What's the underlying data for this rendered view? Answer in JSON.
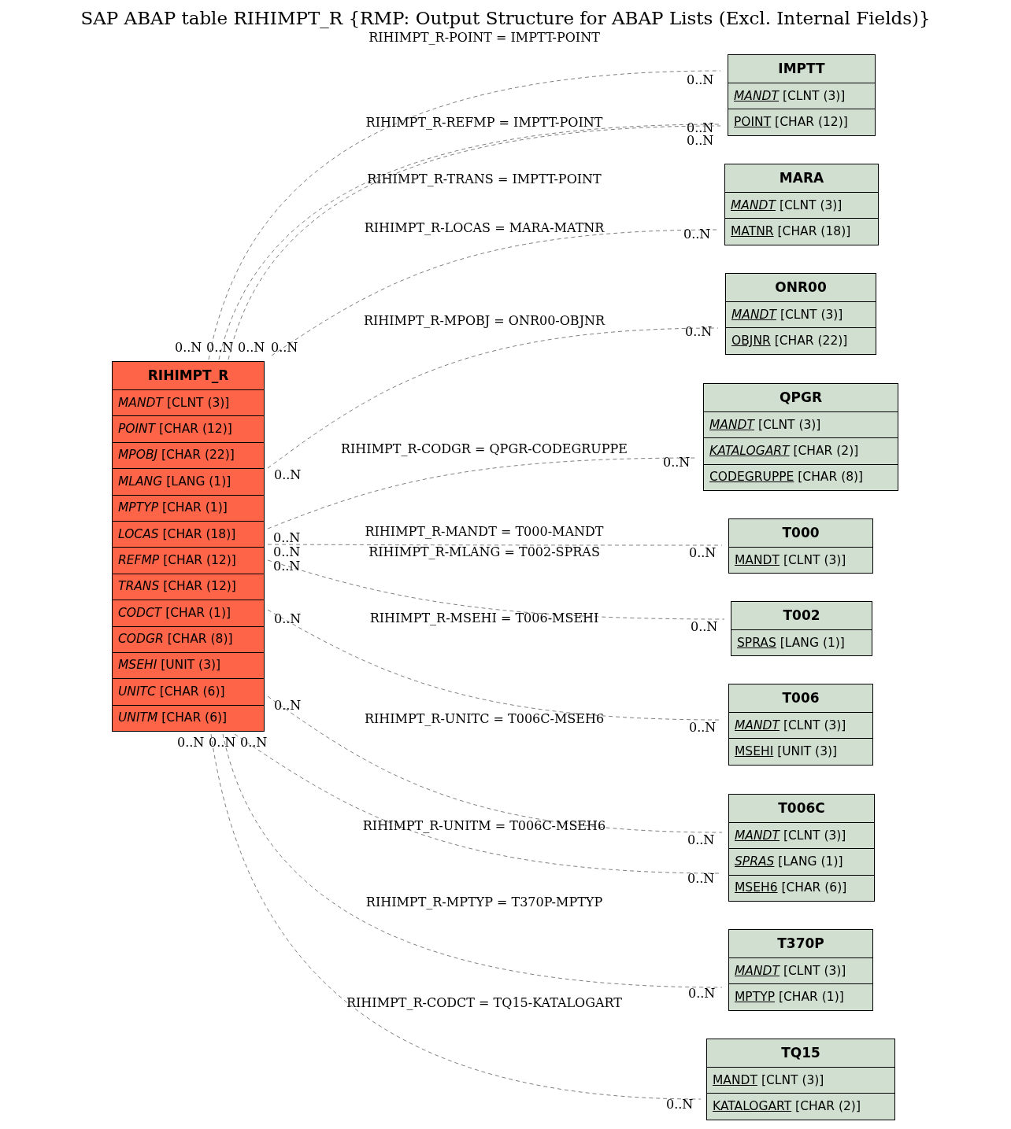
{
  "title": "SAP ABAP table RIHIMPT_R {RMP: Output Structure for ABAP Lists (Excl. Internal Fields)}",
  "main_table": {
    "name": "RIHIMPT_R",
    "fields": [
      {
        "name": "MANDT",
        "type": "[CLNT (3)]",
        "key": false,
        "italic": true
      },
      {
        "name": "POINT",
        "type": "[CHAR (12)]",
        "key": false,
        "italic": true
      },
      {
        "name": "MPOBJ",
        "type": "[CHAR (22)]",
        "key": false,
        "italic": true
      },
      {
        "name": "MLANG",
        "type": "[LANG (1)]",
        "key": false,
        "italic": true
      },
      {
        "name": "MPTYP",
        "type": "[CHAR (1)]",
        "key": false,
        "italic": true
      },
      {
        "name": "LOCAS",
        "type": "[CHAR (18)]",
        "key": false,
        "italic": true
      },
      {
        "name": "REFMP",
        "type": "[CHAR (12)]",
        "key": false,
        "italic": true
      },
      {
        "name": "TRANS",
        "type": "[CHAR (12)]",
        "key": false,
        "italic": true
      },
      {
        "name": "CODCT",
        "type": "[CHAR (1)]",
        "key": false,
        "italic": true
      },
      {
        "name": "CODGR",
        "type": "[CHAR (8)]",
        "key": false,
        "italic": true
      },
      {
        "name": "MSEHI",
        "type": "[UNIT (3)]",
        "key": false,
        "italic": true
      },
      {
        "name": "UNITC",
        "type": "[CHAR (6)]",
        "key": false,
        "italic": true
      },
      {
        "name": "UNITM",
        "type": "[CHAR (6)]",
        "key": false,
        "italic": true
      }
    ]
  },
  "tables": [
    {
      "name": "IMPTT",
      "fields": [
        {
          "name": "MANDT",
          "type": "[CLNT (3)]",
          "key": true,
          "italic": true
        },
        {
          "name": "POINT",
          "type": "[CHAR (12)]",
          "key": true,
          "italic": false
        }
      ]
    },
    {
      "name": "MARA",
      "fields": [
        {
          "name": "MANDT",
          "type": "[CLNT (3)]",
          "key": true,
          "italic": true
        },
        {
          "name": "MATNR",
          "type": "[CHAR (18)]",
          "key": true,
          "italic": false
        }
      ]
    },
    {
      "name": "ONR00",
      "fields": [
        {
          "name": "MANDT",
          "type": "[CLNT (3)]",
          "key": true,
          "italic": true
        },
        {
          "name": "OBJNR",
          "type": "[CHAR (22)]",
          "key": true,
          "italic": false
        }
      ]
    },
    {
      "name": "QPGR",
      "fields": [
        {
          "name": "MANDT",
          "type": "[CLNT (3)]",
          "key": true,
          "italic": true
        },
        {
          "name": "KATALOGART",
          "type": "[CHAR (2)]",
          "key": true,
          "italic": true
        },
        {
          "name": "CODEGRUPPE",
          "type": "[CHAR (8)]",
          "key": true,
          "italic": false
        }
      ]
    },
    {
      "name": "T000",
      "fields": [
        {
          "name": "MANDT",
          "type": "[CLNT (3)]",
          "key": true,
          "italic": false
        }
      ]
    },
    {
      "name": "T002",
      "fields": [
        {
          "name": "SPRAS",
          "type": "[LANG (1)]",
          "key": true,
          "italic": false
        }
      ]
    },
    {
      "name": "T006",
      "fields": [
        {
          "name": "MANDT",
          "type": "[CLNT (3)]",
          "key": true,
          "italic": true
        },
        {
          "name": "MSEHI",
          "type": "[UNIT (3)]",
          "key": true,
          "italic": false
        }
      ]
    },
    {
      "name": "T006C",
      "fields": [
        {
          "name": "MANDT",
          "type": "[CLNT (3)]",
          "key": true,
          "italic": true
        },
        {
          "name": "SPRAS",
          "type": "[LANG (1)]",
          "key": true,
          "italic": true
        },
        {
          "name": "MSEH6",
          "type": "[CHAR (6)]",
          "key": true,
          "italic": false
        }
      ]
    },
    {
      "name": "T370P",
      "fields": [
        {
          "name": "MANDT",
          "type": "[CLNT (3)]",
          "key": true,
          "italic": true
        },
        {
          "name": "MPTYP",
          "type": "[CHAR (1)]",
          "key": true,
          "italic": false
        }
      ]
    },
    {
      "name": "TQ15",
      "fields": [
        {
          "name": "MANDT",
          "type": "[CLNT (3)]",
          "key": true,
          "italic": false
        },
        {
          "name": "KATALOGART",
          "type": "[CHAR (2)]",
          "key": true,
          "italic": false
        }
      ]
    }
  ],
  "relations": [
    {
      "label": "RIHIMPT_R-POINT = IMPTT-POINT",
      "source_cardinality": "0..N",
      "target_cardinality": "0..N"
    },
    {
      "label": "RIHIMPT_R-REFMP = IMPTT-POINT",
      "source_cardinality": "0..N",
      "target_cardinality": "0..N"
    },
    {
      "label": "RIHIMPT_R-TRANS = IMPTT-POINT",
      "source_cardinality": "0..N",
      "target_cardinality": "0..N"
    },
    {
      "label": "RIHIMPT_R-LOCAS = MARA-MATNR",
      "source_cardinality": "0..N",
      "target_cardinality": "0..N"
    },
    {
      "label": "RIHIMPT_R-MPOBJ = ONR00-OBJNR",
      "source_cardinality": "0..N",
      "target_cardinality": "0..N"
    },
    {
      "label": "RIHIMPT_R-CODGR = QPGR-CODEGRUPPE",
      "source_cardinality": "0..N",
      "target_cardinality": "0..N"
    },
    {
      "label": "RIHIMPT_R-MANDT = T000-MANDT",
      "source_cardinality": "0..N",
      "target_cardinality": "0..N"
    },
    {
      "label": "RIHIMPT_R-MLANG = T002-SPRAS",
      "source_cardinality": "0..N",
      "target_cardinality": "0..N"
    },
    {
      "label": "RIHIMPT_R-MSEHI = T006-MSEHI",
      "source_cardinality": "0..N",
      "target_cardinality": "0..N"
    },
    {
      "label": "RIHIMPT_R-UNITC = T006C-MSEH6",
      "source_cardinality": "0..N",
      "target_cardinality": "0..N"
    },
    {
      "label": "RIHIMPT_R-UNITM = T006C-MSEH6",
      "source_cardinality": "0..N",
      "target_cardinality": "0..N"
    },
    {
      "label": "RIHIMPT_R-MPTYP = T370P-MPTYP",
      "source_cardinality": "0..N",
      "target_cardinality": "0..N"
    },
    {
      "label": "RIHIMPT_R-CODCT = TQ15-KATALOGART",
      "source_cardinality": "0..N",
      "target_cardinality": "0..N"
    }
  ]
}
